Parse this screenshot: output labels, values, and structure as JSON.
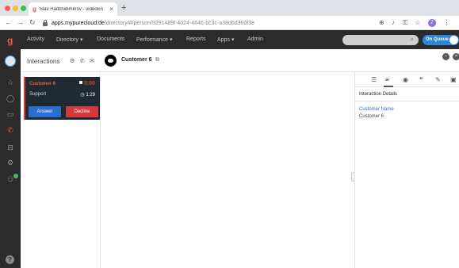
{
  "browser": {
    "tab_title": "Slav Hadzhidimitrov - videoEn",
    "tab_favicon": "genesys-logo",
    "tab_close": "×",
    "new_tab": "+",
    "url_domain": "apps.mypurecloud.de",
    "url_path": "/directory/#/person/9291489f-4024-4646-bc3c-a38d6d360f3e",
    "profile_initial": "Z",
    "icons": [
      "back-icon",
      "forward-icon",
      "reload-icon",
      "lock-icon",
      "extension-icon",
      "mic-icon",
      "key-icon",
      "star-icon",
      "profile-icon",
      "menu-icon"
    ]
  },
  "topnav": {
    "items": [
      {
        "label": "Activity"
      },
      {
        "label": "Directory ▾"
      },
      {
        "label": "Documents"
      },
      {
        "label": "Performance ▾"
      },
      {
        "label": "Reports"
      },
      {
        "label": "Apps ▾"
      },
      {
        "label": "Admin"
      }
    ],
    "search_placeholder": "",
    "queue_toggle_label": "On Queue",
    "queue_toggle_on": true
  },
  "siderail": {
    "brand": "g",
    "icons": [
      "star-icon",
      "chat-icon",
      "video-icon",
      "phone-icon",
      "inbox-icon",
      "settings-icon",
      "interactions-icon",
      "help-icon"
    ],
    "help_glyph": "?",
    "status_color": "#3ec45b"
  },
  "interactions": {
    "title": "Interactions",
    "header_icons": [
      "settings-icon",
      "phone-icon",
      "email-icon"
    ],
    "customer": "Customer 6",
    "card": {
      "name": "Customer 6",
      "timer": "0:00",
      "queue": "Support",
      "wait": "1:29",
      "answer_label": "Answer",
      "decline_label": "Decline"
    }
  },
  "right_panel": {
    "title": "Interaction Details",
    "field_label": "Customer Name",
    "field_value": "Customer 6",
    "toolbar_icons": [
      "script-icon",
      "details-icon",
      "person-icon",
      "quote-icon",
      "edit-icon",
      "wrapup-icon"
    ]
  },
  "colors": {
    "accent": "#2a6fd0",
    "brand": "#e8603c",
    "decline": "#d8383d",
    "nav_bg": "#2b2b2b",
    "queue_on": "#2a85d8"
  }
}
